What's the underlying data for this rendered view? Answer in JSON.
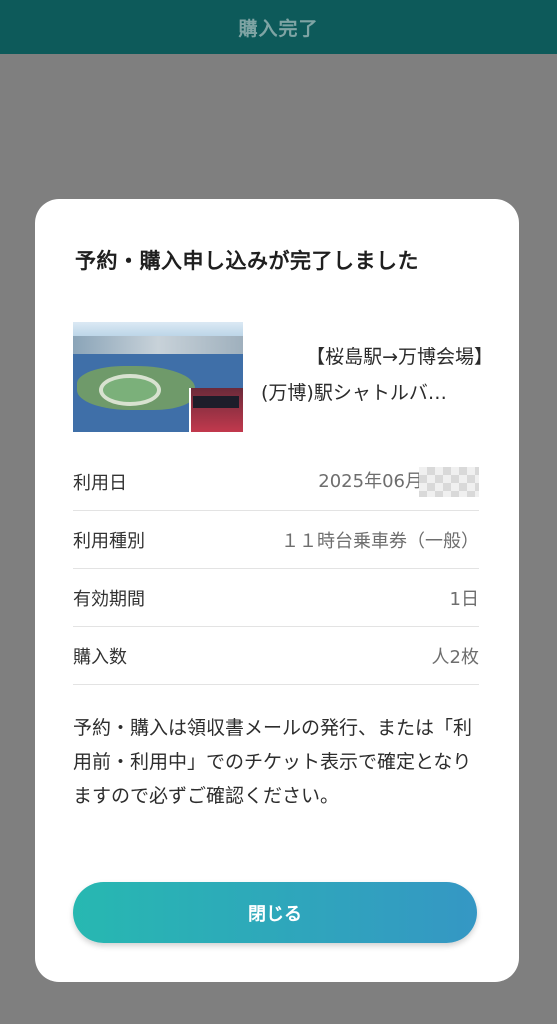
{
  "header": {
    "title": "購入完了"
  },
  "modal": {
    "title": "予約・購入申し込みが完了しました",
    "ticket": {
      "name_line1": "【桜島駅→万博会場】",
      "name_line2": "(万博)駅シャトルバ…"
    },
    "details": [
      {
        "label": "利用日",
        "value": "2025年06月"
      },
      {
        "label": "利用種別",
        "value": "１１時台乗車券（一般）"
      },
      {
        "label": "有効期間",
        "value": "1日"
      },
      {
        "label": "購入数",
        "value": "人2枚"
      }
    ],
    "notice": "予約・購入は領収書メールの発行、または「利用前・利用中」でのチケット表示で確定となりますので必ずご確認ください。",
    "close_label": "閉じる"
  }
}
